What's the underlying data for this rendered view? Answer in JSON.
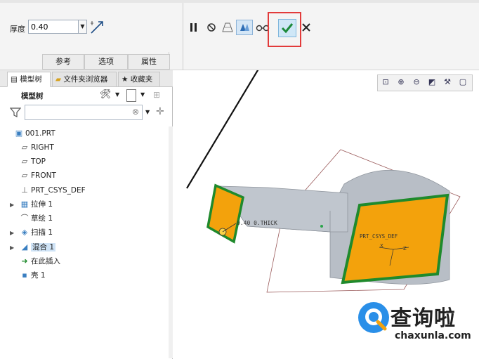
{
  "ribbon": {
    "thickness_label": "厚度",
    "thickness_value": "0.40",
    "tabs": [
      "参考",
      "选项",
      "属性"
    ]
  },
  "panel": {
    "tabs": [
      "模型树",
      "文件夹浏览器",
      "收藏夹"
    ],
    "tree_title": "模型树",
    "tree_items": [
      {
        "label": "001.PRT",
        "icon": "part-icon",
        "expandable": false
      },
      {
        "label": "RIGHT",
        "icon": "datum-plane-icon",
        "expandable": false
      },
      {
        "label": "TOP",
        "icon": "datum-plane-icon",
        "expandable": false
      },
      {
        "label": "FRONT",
        "icon": "datum-plane-icon",
        "expandable": false
      },
      {
        "label": "PRT_CSYS_DEF",
        "icon": "csys-icon",
        "expandable": false
      },
      {
        "label": "拉伸 1",
        "icon": "extrude-icon",
        "expandable": true
      },
      {
        "label": "草绘 1",
        "icon": "sketch-icon",
        "expandable": false
      },
      {
        "label": "扫描 1",
        "icon": "sweep-icon",
        "expandable": true
      },
      {
        "label": "混合 1",
        "icon": "blend-icon",
        "expandable": true
      },
      {
        "label": "在此插入",
        "icon": "insert-here-icon",
        "expandable": false
      },
      {
        "label": "壳 1",
        "icon": "shell-icon",
        "expandable": false
      }
    ]
  },
  "viewport": {
    "dim_label": "0.40 0.THICK",
    "csys_label": "PRT_CSYS_DEF",
    "axis_x": "X",
    "axis_z": "Z"
  },
  "colors": {
    "model_gray": "#b8bec6",
    "face_orange": "#f3a20c",
    "edge_green": "#1f8a2c",
    "highlight_red": "#e23b3b"
  },
  "watermark": {
    "title": "查询啦",
    "subtitle": "chaxunla.com"
  }
}
